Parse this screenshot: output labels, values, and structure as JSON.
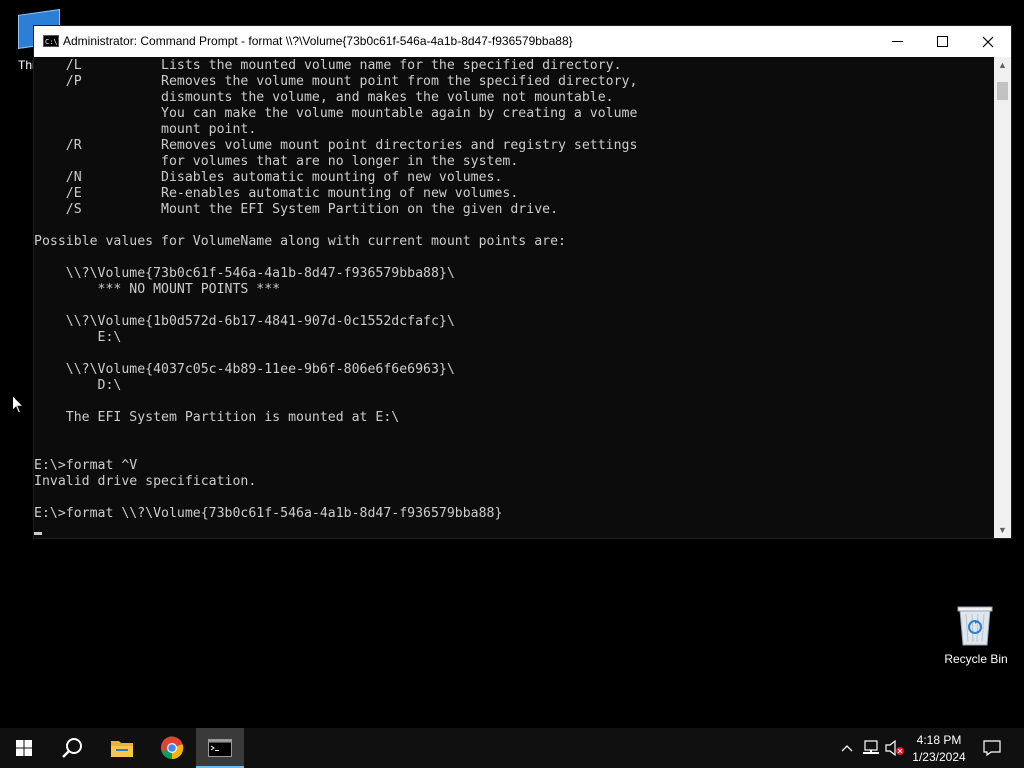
{
  "desktop": {
    "this_pc_label": "Thi",
    "recycle_bin_label": "Recycle Bin"
  },
  "window": {
    "title": "Administrator: Command Prompt - format  \\\\?\\Volume{73b0c61f-546a-4a1b-8d47-f936579bba88}",
    "minimize_label": "Minimize",
    "maximize_label": "Maximize",
    "close_label": "Close"
  },
  "console": {
    "text": "    /L          Lists the mounted volume name for the specified directory.\n    /P          Removes the volume mount point from the specified directory,\n                dismounts the volume, and makes the volume not mountable.\n                You can make the volume mountable again by creating a volume\n                mount point.\n    /R          Removes volume mount point directories and registry settings\n                for volumes that are no longer in the system.\n    /N          Disables automatic mounting of new volumes.\n    /E          Re-enables automatic mounting of new volumes.\n    /S          Mount the EFI System Partition on the given drive.\n\nPossible values for VolumeName along with current mount points are:\n\n    \\\\?\\Volume{73b0c61f-546a-4a1b-8d47-f936579bba88}\\\n        *** NO MOUNT POINTS ***\n\n    \\\\?\\Volume{1b0d572d-6b17-4841-907d-0c1552dcfafc}\\\n        E:\\\n\n    \\\\?\\Volume{4037c05c-4b89-11ee-9b6f-806e6f6e6963}\\\n        D:\\\n\n    The EFI System Partition is mounted at E:\\\n\n\nE:\\>format ^V\nInvalid drive specification.\n\nE:\\>format \\\\?\\Volume{73b0c61f-546a-4a1b-8d47-f936579bba88}"
  },
  "taskbar": {
    "time": "4:18 PM",
    "date": "1/23/2024"
  },
  "colors": {
    "console_bg": "#0c0c0c",
    "console_fg": "#cccccc",
    "taskbar_bg": "#101010",
    "accent": "#76b9ed"
  }
}
